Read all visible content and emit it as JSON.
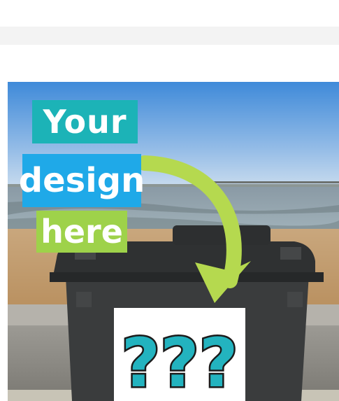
{
  "banner": {
    "line1": "Your",
    "line2": "design",
    "line3": "here",
    "line1_bg": "#1cb3b7",
    "line2_bg": "#1fa9e8",
    "line3_bg": "#9ed24a",
    "text_color": "#ffffff"
  },
  "placeholder": {
    "text": "???",
    "color": "#23b3bf",
    "outline": "#1b1b1b"
  },
  "arrow": {
    "color": "#b5d94f"
  },
  "scene": {
    "sky_top": "#3f8ad9",
    "sky_bottom": "#c8dbee",
    "bin_color": "#3a3c3d"
  }
}
